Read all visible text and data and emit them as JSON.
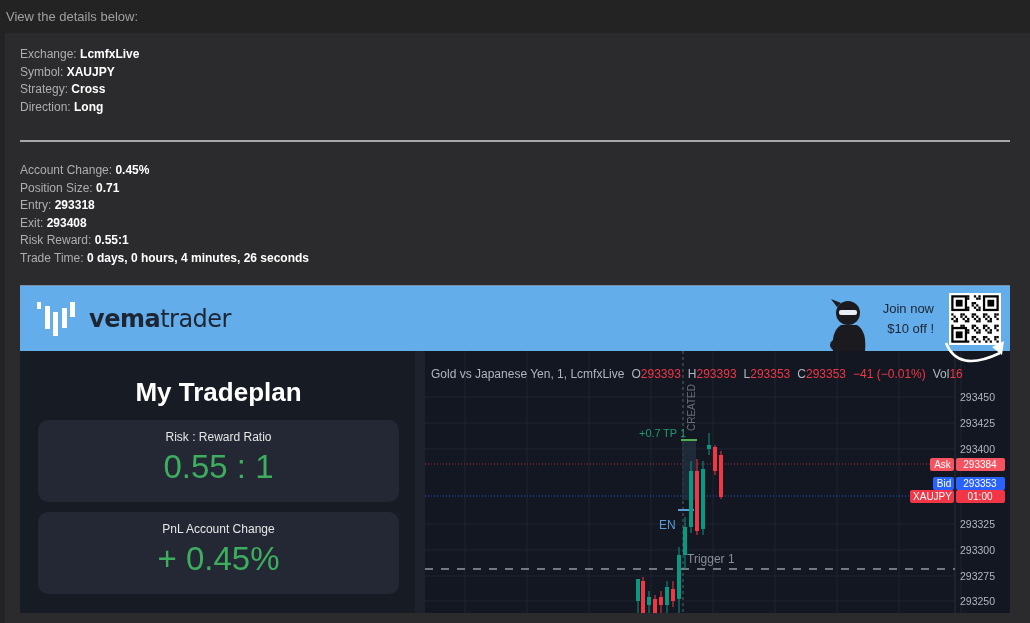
{
  "intro": "View the details below:",
  "details": [
    {
      "label": "Exchange:",
      "value": "LcmfxLive"
    },
    {
      "label": "Symbol:",
      "value": "XAUJPY"
    },
    {
      "label": "Strategy:",
      "value": "Cross"
    },
    {
      "label": "Direction:",
      "value": "Long"
    }
  ],
  "stats": [
    {
      "label": "Account Change:",
      "value": "0.45%"
    },
    {
      "label": "Position Size:",
      "value": "0.71"
    },
    {
      "label": "Entry:",
      "value": "293318"
    },
    {
      "label": "Exit:",
      "value": "293408"
    },
    {
      "label": "Risk Reward:",
      "value": "0.55:1"
    },
    {
      "label": "Trade Time:",
      "value": "0 days, 0 hours, 4 minutes, 26 seconds"
    }
  ],
  "banner": {
    "brand_bold": "vema",
    "brand_light": "trader",
    "promo_lines": [
      "Join now",
      "$10 off !"
    ]
  },
  "tradeplan": {
    "title": "My Tradeplan",
    "cards": [
      {
        "label": "Risk : Reward Ratio",
        "value": "0.55 : 1"
      },
      {
        "label": "PnL Account Change",
        "value": "+ 0.45%"
      }
    ]
  },
  "chart": {
    "legend": {
      "name": "Gold vs Japanese Yen, 1, LcmfxLive",
      "ohlc": [
        {
          "key": "O",
          "value": "293393"
        },
        {
          "key": "H",
          "value": "293393"
        },
        {
          "key": "L",
          "value": "293353"
        },
        {
          "key": "C",
          "value": "293353"
        }
      ],
      "change": "−41 (−0.01%)",
      "vol_label": "Vol",
      "vol": "16"
    },
    "price_ticks": [
      "293450",
      "293425",
      "293400",
      "293325",
      "293300",
      "293275",
      "293250"
    ],
    "price_tags": [
      {
        "label": "Ask",
        "value": "293384",
        "color": "#f7525f"
      },
      {
        "label": "Bid",
        "value": "293353",
        "color": "#2962ff"
      },
      {
        "label": "XAUJPY",
        "value": "01:00",
        "color": "#f23645"
      }
    ],
    "markers": [
      {
        "kind": "vertical",
        "text": "CREATED"
      },
      {
        "kind": "profit",
        "text": "+0.7"
      },
      {
        "kind": "target",
        "text": "TP 1"
      },
      {
        "kind": "entry",
        "text": "EN"
      },
      {
        "kind": "trigger",
        "text": "Trigger 1"
      }
    ]
  }
}
